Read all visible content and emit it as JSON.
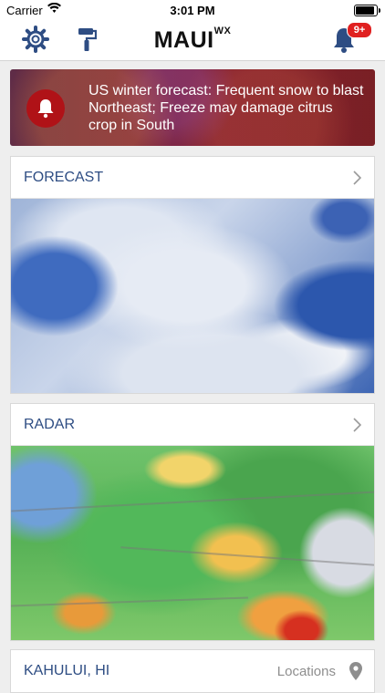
{
  "status_bar": {
    "carrier": "Carrier",
    "time": "3:01 PM",
    "battery_level": 1.0
  },
  "nav": {
    "logo_main": "MAUI",
    "logo_sup": "WX",
    "notification_badge": "9+",
    "icons": [
      "gear-icon",
      "paint-roller-icon",
      "bell-icon"
    ],
    "accent_color": "#2e4d83"
  },
  "alert": {
    "text": "US winter forecast: Frequent snow to blast Northeast; Freeze may damage citrus crop in South",
    "icon": "bell-icon",
    "icon_bg_color": "#b01217"
  },
  "cards": {
    "forecast": {
      "title": "FORECAST",
      "icon": "chevron-right-icon"
    },
    "radar": {
      "title": "RADAR",
      "icon": "chevron-right-icon"
    }
  },
  "location": {
    "name": "KAHULUI, HI",
    "locations_label": "Locations",
    "icon": "map-pin-icon"
  }
}
